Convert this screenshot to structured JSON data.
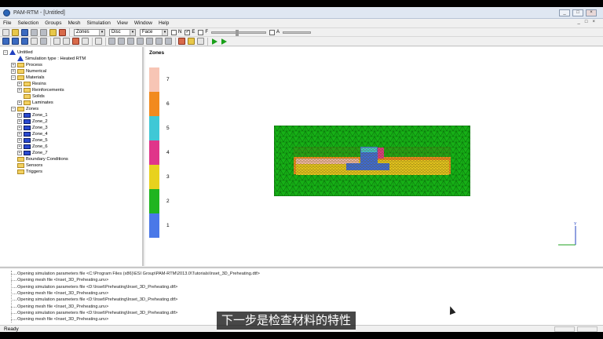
{
  "window": {
    "title": "PAM-RTM - [Untitled]",
    "controls": [
      "_",
      "□",
      "×"
    ],
    "mdi_controls": [
      "_",
      "□",
      "×"
    ]
  },
  "menu": [
    "File",
    "Selection",
    "Groups",
    "Mesh",
    "Simulation",
    "View",
    "Window",
    "Help"
  ],
  "toolbar": {
    "combo_zones": "Zones",
    "combo_disc": "Disc",
    "combo_face": "Face",
    "check_n": "N",
    "check_e": "E",
    "check_f": "F",
    "check_a": "A"
  },
  "tree": {
    "root": "Untitled",
    "sim_type": "Simulation type : Heated RTM",
    "process": "Process",
    "numerical": "Numerical",
    "materials": "Materials",
    "resins": "Resins",
    "reinforcements": "Reinforcements",
    "solids": "Solids",
    "laminates": "Laminates",
    "zones": "Zones",
    "zone_items": [
      "Zone_1",
      "Zone_2",
      "Zone_3",
      "Zone_4",
      "Zone_5",
      "Zone_6",
      "Zone_7"
    ],
    "boundary": "Boundary Conditions",
    "sensors": "Sensors",
    "triggers": "Triggers"
  },
  "viewport": {
    "title": "Zones",
    "legend": [
      {
        "label": "7",
        "color": "#f7c5b5"
      },
      {
        "label": "6",
        "color": "#f28a1e"
      },
      {
        "label": "5",
        "color": "#3fc8d6"
      },
      {
        "label": "4",
        "color": "#e0358a"
      },
      {
        "label": "3",
        "color": "#e8d21e"
      },
      {
        "label": "2",
        "color": "#1fb51f"
      },
      {
        "label": "1",
        "color": "#4a78e8"
      }
    ],
    "axis_y": "Y"
  },
  "log": [
    "Opening simulation parameters file <C:\\Program Files (x86)\\ESI Group\\PAM-RTM\\2013.0\\Tutorials\\Inset_3D_Preheating.dtf>",
    "Opening mesh file <Inset_3D_Preheating.unv>",
    "Opening simulation parameters file <D:\\Inset\\Preheating\\Inset_3D_Preheating.dtf>",
    "Opening mesh file <Inset_3D_Preheating.unv>",
    "Opening simulation parameters file <D:\\Inset\\Preheating\\Inset_3D_Preheating.dtf>",
    "Opening mesh file <Inset_3D_Preheating.unv>",
    "Opening simulation parameters file <D:\\Inset\\Preheating\\Inset_3D_Preheating.dtf>",
    "Opening mesh file <Inset_3D_Preheating.unv>"
  ],
  "status": "Ready",
  "subtitle": "下一步是检查材料的特性"
}
